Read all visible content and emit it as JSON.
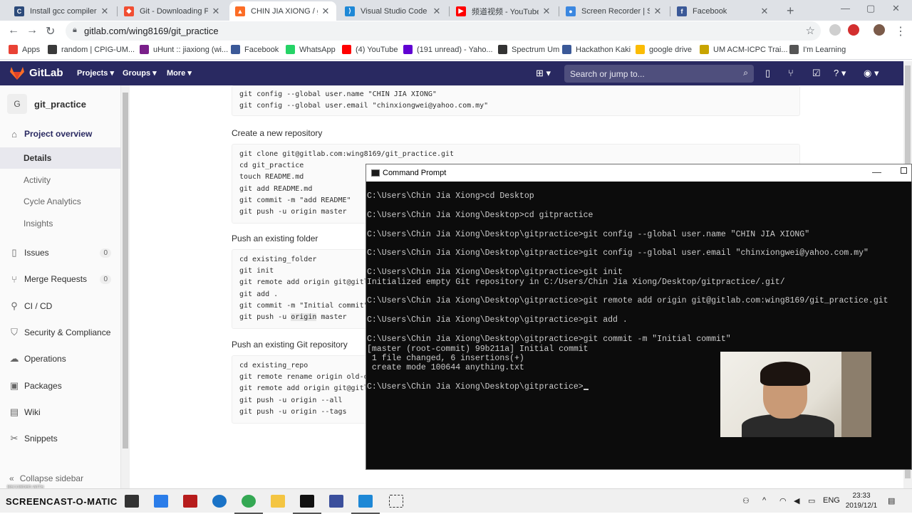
{
  "browser": {
    "tabs": [
      {
        "title": "Install gcc compiler on",
        "color": "#2c4a7a",
        "glyph": "C"
      },
      {
        "title": "Git - Downloading Pac",
        "color": "#f14e32",
        "glyph": "◆"
      },
      {
        "title": "CHIN JIA XIONG / git_",
        "color": "#fc6d26",
        "glyph": "▲"
      },
      {
        "title": "Visual Studio Code - C",
        "color": "#1e88d6",
        "glyph": "⟩"
      },
      {
        "title": "频道视频 - YouTube St",
        "color": "#ff0000",
        "glyph": "▶"
      },
      {
        "title": "Screen Recorder | Scre",
        "color": "#3b87e0",
        "glyph": "●"
      },
      {
        "title": "Facebook",
        "color": "#3b5998",
        "glyph": "f"
      }
    ],
    "url": "gitlab.com/wing8169/git_practice",
    "bookmarks": [
      {
        "label": "Apps",
        "color": "#e94235"
      },
      {
        "label": "random | CPIG-UM...",
        "color": "#3a3a3a"
      },
      {
        "label": "uHunt :: jiaxiong (wi...",
        "color": "#7a1f8a"
      },
      {
        "label": "Facebook",
        "color": "#3b5998"
      },
      {
        "label": "WhatsApp",
        "color": "#25d366"
      },
      {
        "label": "(4) YouTube",
        "color": "#ff0000"
      },
      {
        "label": "(191 unread) - Yaho...",
        "color": "#6001d2"
      },
      {
        "label": "Spectrum Um",
        "color": "#333333"
      },
      {
        "label": "Hackathon Kaki",
        "color": "#3b5998"
      },
      {
        "label": "google drive",
        "color": "#fbbc04"
      },
      {
        "label": "UM ACM-ICPC Trai...",
        "color": "#c8a400"
      },
      {
        "label": "I'm Learning",
        "color": "#555555"
      }
    ]
  },
  "gitlab": {
    "brand": "GitLab",
    "menus": [
      "Projects",
      "Groups",
      "More"
    ],
    "search_placeholder": "Search or jump to...",
    "project_initial": "G",
    "project_name": "git_practice",
    "sidebar": {
      "overview": "Project overview",
      "overview_sub": [
        "Details",
        "Activity",
        "Cycle Analytics",
        "Insights"
      ],
      "items": [
        {
          "label": "Issues",
          "icon": "issues-icon",
          "glyph": "▯",
          "count": "0"
        },
        {
          "label": "Merge Requests",
          "icon": "merge-request-icon",
          "glyph": "⑂",
          "count": "0"
        },
        {
          "label": "CI / CD",
          "icon": "rocket-icon",
          "glyph": "⚲"
        },
        {
          "label": "Security & Compliance",
          "icon": "shield-icon",
          "glyph": "⛉"
        },
        {
          "label": "Operations",
          "icon": "cloud-icon",
          "glyph": "☁"
        },
        {
          "label": "Packages",
          "icon": "package-icon",
          "glyph": "▣"
        },
        {
          "label": "Wiki",
          "icon": "book-icon",
          "glyph": "▤"
        },
        {
          "label": "Snippets",
          "icon": "scissors-icon",
          "glyph": "✂"
        }
      ],
      "collapse": "Collapse sidebar"
    },
    "sections": {
      "global_code": "git config --global user.name \"CHIN JIA XIONG\"\ngit config --global user.email \"chinxiongwei@yahoo.com.my\"",
      "new_repo_title": "Create a new repository",
      "new_repo_code": "git clone git@gitlab.com:wing8169/git_practice.git\ncd git_practice\ntouch README.md\ngit add README.md\ngit commit -m \"add README\"\ngit push -u origin master",
      "existing_folder_title": "Push an existing folder",
      "existing_folder_code_1": "cd existing_folder\ngit init\ngit remote add origin git@gitl\ngit add .\ngit commit -m \"Initial commit\"\ngit push -u ",
      "existing_folder_hl": "origin",
      "existing_folder_code_2": " master",
      "existing_repo_title": "Push an existing Git repository",
      "existing_repo_code": "cd existing_repo\ngit remote rename origin old-o\ngit remote add origin git@gitl\ngit push -u origin --all\ngit push -u origin --tags"
    }
  },
  "cmd": {
    "title": "Command Prompt",
    "output": "C:\\Users\\Chin Jia Xiong>cd Desktop\n\nC:\\Users\\Chin Jia Xiong\\Desktop>cd gitpractice\n\nC:\\Users\\Chin Jia Xiong\\Desktop\\gitpractice>git config --global user.name \"CHIN JIA XIONG\"\n\nC:\\Users\\Chin Jia Xiong\\Desktop\\gitpractice>git config --global user.email \"chinxiongwei@yahoo.com.my\"\n\nC:\\Users\\Chin Jia Xiong\\Desktop\\gitpractice>git init\nInitialized empty Git repository in C:/Users/Chin Jia Xiong/Desktop/gitpractice/.git/\n\nC:\\Users\\Chin Jia Xiong\\Desktop\\gitpractice>git remote add origin git@gitlab.com:wing8169/git_practice.git\n\nC:\\Users\\Chin Jia Xiong\\Desktop\\gitpractice>git add .\n\nC:\\Users\\Chin Jia Xiong\\Desktop\\gitpractice>git commit -m \"Initial commit\"\n[master (root-commit) 99b211a] Initial commit\n 1 file changed, 6 insertions(+)\n create mode 100644 anything.txt\n\nC:\\Users\\Chin Jia Xiong\\Desktop\\gitpractice>"
  },
  "taskbar": {
    "watermark": "SCREENCAST-O-MATIC",
    "watermark_small": "RECORDED WITH",
    "lang": "ENG",
    "time": "23:33",
    "date": "2019/12/1"
  }
}
